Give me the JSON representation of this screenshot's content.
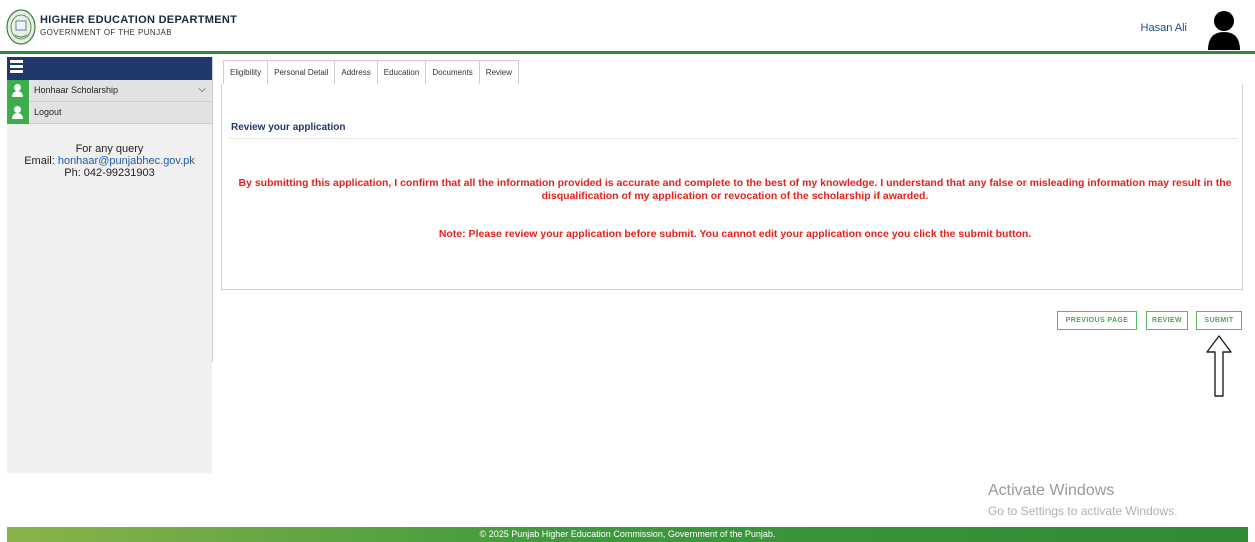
{
  "header": {
    "dept_title": "HIGHER EDUCATION DEPARTMENT",
    "dept_subtitle": "GOVERNMENT OF THE PUNJAB",
    "user_name": "Hasan Ali",
    "logo_icon": "punjab-emblem-icon",
    "avatar_icon": "user-avatar-icon"
  },
  "sidebar": {
    "menu_icon": "hamburger-menu-icon",
    "items": [
      {
        "label": "Honhaar Scholarship",
        "icon": "user-icon",
        "has_dropdown": true
      },
      {
        "label": "Logout",
        "icon": "user-icon",
        "has_dropdown": false
      }
    ],
    "query": {
      "heading": "For any query",
      "email_label": "Email:",
      "email": "honhaar@punjabhec.gov.pk",
      "phone": "Ph: 042-99231903"
    }
  },
  "tabs": [
    {
      "label": "Eligibility",
      "active": false
    },
    {
      "label": "Personal Detail",
      "active": false
    },
    {
      "label": "Address",
      "active": false
    },
    {
      "label": "Education",
      "active": false
    },
    {
      "label": "Documents",
      "active": false
    },
    {
      "label": "Review",
      "active": true
    }
  ],
  "review": {
    "heading": "Review your application",
    "confirmation": "By submitting this application, I confirm that all the information provided is accurate and complete to the best of my knowledge. I understand that any false or misleading information may result in the disqualification of my application or revocation of the scholarship if awarded.",
    "note": "Note: Please review your application before submit. You cannot edit your application once you click the submit button."
  },
  "buttons": {
    "previous": "PREVIOUS PAGE",
    "review": "REVIEW",
    "submit": "SUBMIT"
  },
  "watermark": {
    "title": "Activate Windows",
    "subtitle": "Go to Settings to activate Windows."
  },
  "footer": {
    "text": "© 2025 Punjab Higher Education Commission, Government of the Punjab."
  },
  "colors": {
    "accent_green": "#2e8b3c",
    "navy": "#21386c",
    "alert_red": "#e8201c",
    "link_blue": "#1f5aa6"
  }
}
